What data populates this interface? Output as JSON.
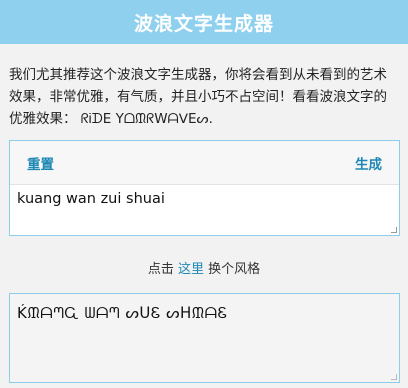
{
  "header": {
    "title": "波浪文字生成器"
  },
  "intro": {
    "text": "我们尤其推荐这个波浪文字生成器，你将会看到从未看到的艺术效果，非常优雅，有气质，并且小巧不占空间！看看波浪文字的优雅效果： ᖇᎥᗪE YᗝᙢᖇWᗩᐯEᔕ."
  },
  "panel": {
    "reset_label": "重置",
    "generate_label": "生成",
    "input_value": "kuang wan zui shuai"
  },
  "style_switch": {
    "prefix": "点击",
    "link_label": "这里",
    "suffix": "换个风格"
  },
  "output": {
    "value": "ḰᙢᗩᘉᏩ ᗯᗩᘉ ᔕᑌᏋ ᔕᕼᙢᗩᏋ"
  }
}
